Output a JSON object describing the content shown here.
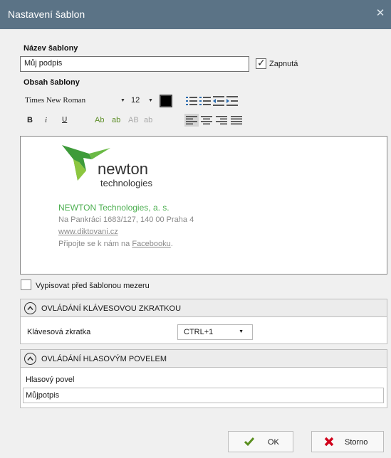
{
  "window": {
    "title": "Nastavení šablon"
  },
  "template_name": {
    "label": "Název šablony",
    "value": "Můj podpis"
  },
  "enabled": {
    "label": "Zapnutá",
    "checked": true
  },
  "content": {
    "label": "Obsah šablony",
    "font_family": "Times New Roman",
    "font_size": "12",
    "text_color": "#000000",
    "format": {
      "bold": "B",
      "italic": "i",
      "underline": "U",
      "ab_case": "Ab",
      "ab_lower": "ab",
      "ab_upper": "AB",
      "ab_lower_gray": "ab"
    }
  },
  "signature": {
    "logo_text_main": "newton",
    "logo_text_sub": "technologies",
    "company": "NEWTON Technologies, a. s.",
    "address": "Na Pankráci 1683/127, 140 00 Praha 4",
    "web": "www.diktovani.cz",
    "connect_prefix": "Připojte se k nám na ",
    "connect_link": "Facebooku",
    "connect_suffix": "."
  },
  "space_before": {
    "label": "Vypisovat před šablonou mezeru",
    "checked": false
  },
  "shortcut_section": {
    "title": "OVLÁDÁNÍ KLÁVESOVOU ZKRATKOU",
    "field_label": "Klávesová zkratka",
    "value": "CTRL+1"
  },
  "voice_section": {
    "title": "OVLÁDÁNÍ HLASOVÝM POVELEM",
    "field_label": "Hlasový povel",
    "value": "Můjpotpis"
  },
  "buttons": {
    "ok": "OK",
    "cancel": "Storno"
  },
  "colors": {
    "titlebar": "#5b7386",
    "brand_green": "#4caf50",
    "ok_check": "#5a8f1f",
    "cancel_x": "#d0021b"
  }
}
